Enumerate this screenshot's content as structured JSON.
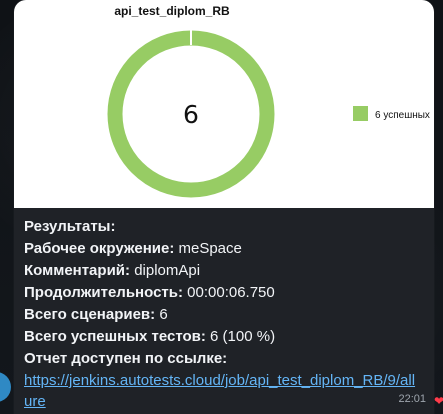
{
  "chat": {
    "time": "22:01"
  },
  "chart_data": {
    "type": "pie",
    "title": "api_test_diplom_RB",
    "center_label": "6",
    "values": [
      6
    ],
    "categories": [
      "6 успешных"
    ],
    "colors": [
      "#97cc64"
    ],
    "legend_position": "right"
  },
  "report": {
    "results_heading": "Результаты:",
    "environment_label": "Рабочее окружение:",
    "environment_value": "meSpace",
    "comment_label": "Комментарий:",
    "comment_value": "diplomApi",
    "duration_label": "Продолжительность:",
    "duration_value": "00:00:06.750",
    "scenarios_label": "Всего сценариев:",
    "scenarios_value": "6",
    "successful_tests_label": "Всего успешных тестов:",
    "successful_tests_value": "6 (100 %)",
    "report_link_label": "Отчет доступен по ссылке:",
    "report_link": "https://jenkins.autotests.cloud/job/api_test_diplom_RB/9/allure"
  },
  "icons": {
    "heart": "heart-icon"
  }
}
